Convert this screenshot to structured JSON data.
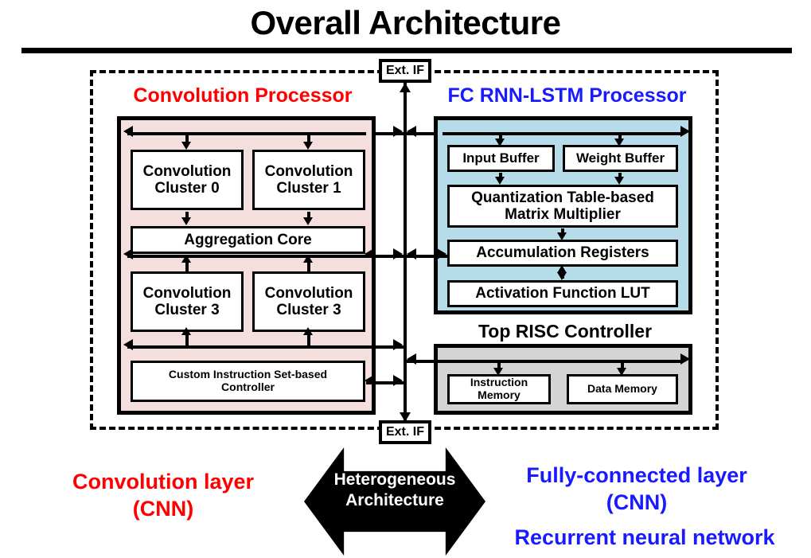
{
  "page": {
    "title": "Overall Architecture"
  },
  "chip": {
    "ext_if_top": "Ext. IF",
    "ext_if_bottom": "Ext. IF"
  },
  "convolution_processor": {
    "heading": "Convolution Processor",
    "heading_color": "#ff0000",
    "fill_color": "#f5dede",
    "blocks": [
      {
        "id": "conv-cluster-0",
        "label": "Convolution\nCluster 0"
      },
      {
        "id": "conv-cluster-1",
        "label": "Convolution\nCluster 1"
      },
      {
        "id": "aggregation-core",
        "label": "Aggregation Core"
      },
      {
        "id": "conv-cluster-2",
        "label": "Convolution\nCluster 3"
      },
      {
        "id": "conv-cluster-3",
        "label": "Convolution\nCluster 3"
      },
      {
        "id": "custom-controller",
        "label": "Custom Instruction Set-based\nController"
      }
    ]
  },
  "fc_processor": {
    "heading": "FC RNN-LSTM Processor",
    "heading_color": "#1a1aff",
    "fill_color": "#b5dce8",
    "blocks": [
      {
        "id": "input-buffer",
        "label": "Input Buffer"
      },
      {
        "id": "weight-buffer",
        "label": "Weight Buffer"
      },
      {
        "id": "matrix-multiplier",
        "label": "Quantization Table-based\nMatrix Multiplier"
      },
      {
        "id": "accumulation-registers",
        "label": "Accumulation Registers"
      },
      {
        "id": "activation-lut",
        "label": "Activation Function LUT"
      }
    ]
  },
  "risc_controller": {
    "heading": "Top RISC Controller",
    "heading_color": "#000000",
    "fill_color": "#d4d4d4",
    "blocks": [
      {
        "id": "instruction-memory",
        "label": "Instruction\nMemory"
      },
      {
        "id": "data-memory",
        "label": "Data Memory"
      }
    ]
  },
  "footer": {
    "left_caption": "Convolution layer\n(CNN)",
    "left_caption_color": "#ff0000",
    "center_label": "Heterogeneous\nArchitecture",
    "center_label_color": "#ffffff",
    "right_caption_1": "Fully-connected layer\n(CNN)",
    "right_caption_2": "Recurrent neural network",
    "right_caption_color": "#1a1aff"
  }
}
